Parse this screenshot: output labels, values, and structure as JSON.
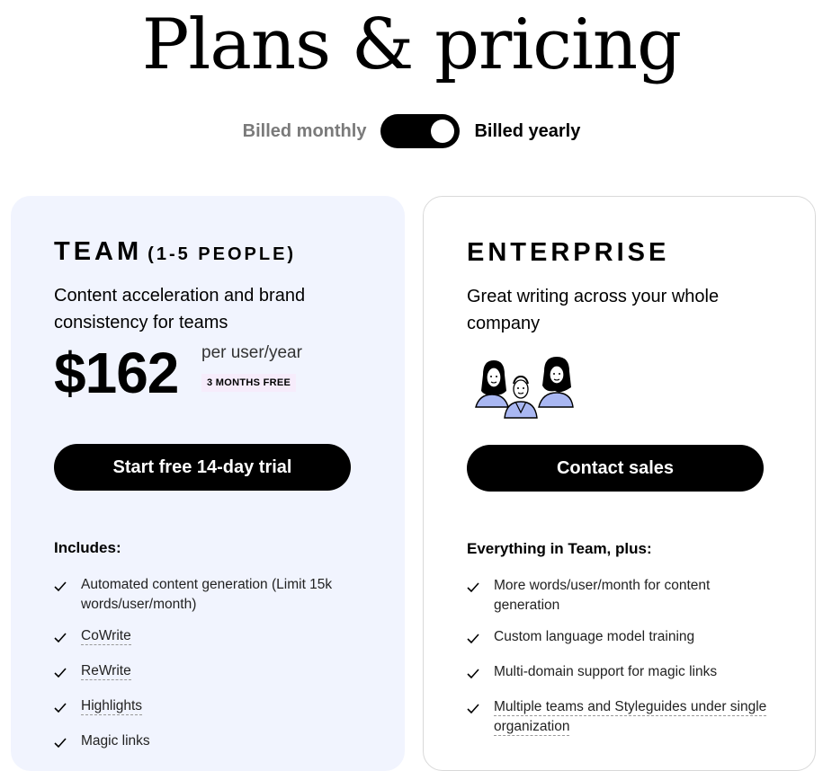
{
  "page": {
    "title": "Plans & pricing"
  },
  "billing": {
    "monthly_label": "Billed monthly",
    "yearly_label": "Billed yearly",
    "selected": "yearly"
  },
  "team": {
    "name": "TEAM",
    "name_sub": "(1-5 PEOPLE)",
    "description": "Content acceleration and brand consistency for teams",
    "price": "$162",
    "price_unit": "per user/year",
    "promo": "3 MONTHS FREE",
    "cta": "Start free 14-day trial",
    "includes_title": "Includes:",
    "features": [
      {
        "text": "Automated content generation (Limit 15k words/user/month)",
        "dashed": false
      },
      {
        "text": "CoWrite",
        "dashed": true
      },
      {
        "text": "ReWrite",
        "dashed": true
      },
      {
        "text": "Highlights",
        "dashed": true
      },
      {
        "text": "Magic links",
        "dashed": false
      }
    ]
  },
  "enterprise": {
    "name": "ENTERPRISE",
    "description": "Great writing across your whole company",
    "cta": "Contact sales",
    "includes_title": "Everything in Team, plus:",
    "features": [
      {
        "text": "More words/user/month for content generation",
        "dashed": false
      },
      {
        "text": "Custom language model training",
        "dashed": false
      },
      {
        "text": "Multi-domain support for magic links",
        "dashed": false
      },
      {
        "text": "Multiple teams and Styleguides under single organization",
        "dashed": true
      }
    ]
  },
  "colors": {
    "team_card_bg": "#f1f4fe",
    "button_bg": "#000000",
    "promo_bg": "#f6ecfb",
    "illustration_accent": "#a9b7f2"
  },
  "icons": {
    "feature_check": "check-icon",
    "enterprise_illustration": "people-illustration-icon"
  }
}
